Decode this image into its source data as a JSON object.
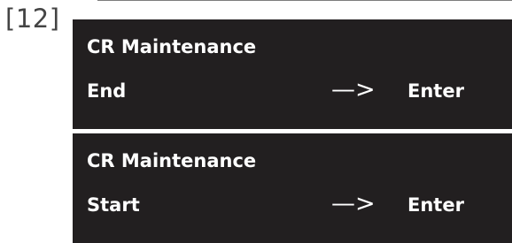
{
  "step_label": "[12]",
  "displays": [
    {
      "line1": "CR Maintenance",
      "line2_left": "End",
      "arrow": "—>",
      "line2_right": "Enter"
    },
    {
      "line1": "CR Maintenance",
      "line2_left": "Start",
      "arrow": "—>",
      "line2_right": "Enter"
    }
  ],
  "colors": {
    "lcd_background": "#221f20",
    "lcd_text": "#ffffff",
    "label_text": "#444444"
  }
}
